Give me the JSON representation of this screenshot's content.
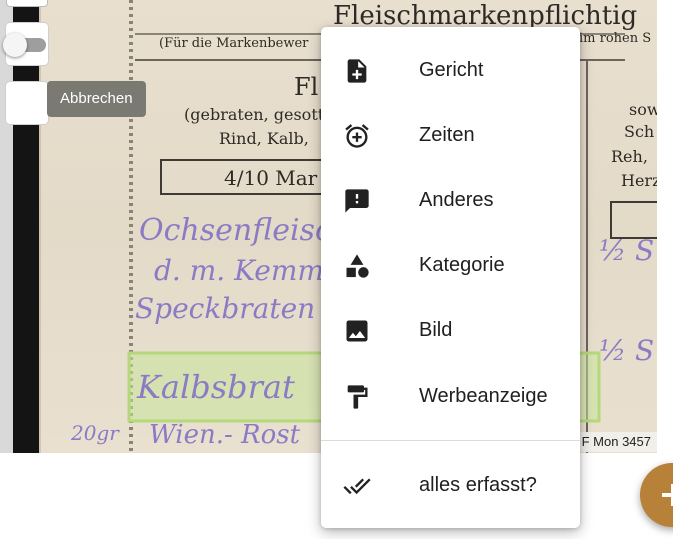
{
  "toggle": {
    "state": "off"
  },
  "tooltip": {
    "cancel_label": "Abbrechen"
  },
  "document": {
    "reference": "F Mon 3457",
    "heading_text": "Fleischmarkenpflichtig",
    "subheading_text": "(Für die Markenbewer",
    "subheading_right": "im rohen S",
    "card_title": "Fl",
    "card_line1": "(gebraten, gesotte",
    "card_line2": "Rind, Kalb,",
    "card_ration": "4/10 Mar",
    "right_line1": "sow",
    "right_line2": "Sch",
    "right_line3": "Reh,",
    "right_line4": "Herz",
    "handwriting_1": "Ochsenfleisch",
    "handwriting_2": "d. m. Kemm",
    "handwriting_3": "Speckbraten",
    "handwriting_4": "Kalbsbrat",
    "handwriting_5": "Wien.- Rost",
    "handwriting_6": "20gr"
  },
  "menu": {
    "items": [
      {
        "label": "Gericht",
        "icon": "note-add-icon"
      },
      {
        "label": "Zeiten",
        "icon": "alarm-add-icon"
      },
      {
        "label": "Anderes",
        "icon": "feedback-icon"
      },
      {
        "label": "Kategorie",
        "icon": "category-icon"
      },
      {
        "label": "Bild",
        "icon": "image-icon"
      },
      {
        "label": "Werbeanzeige",
        "icon": "format-paint-icon"
      }
    ],
    "done_item": {
      "label": "alles erfasst?",
      "icon": "done-all-icon"
    }
  },
  "fab": {
    "icon": "plus-icon",
    "color": "#b8813a"
  },
  "colors": {
    "menu_text": "#202020",
    "tooltip_bg": "#7a7a72",
    "highlight": "#c8e39a"
  }
}
